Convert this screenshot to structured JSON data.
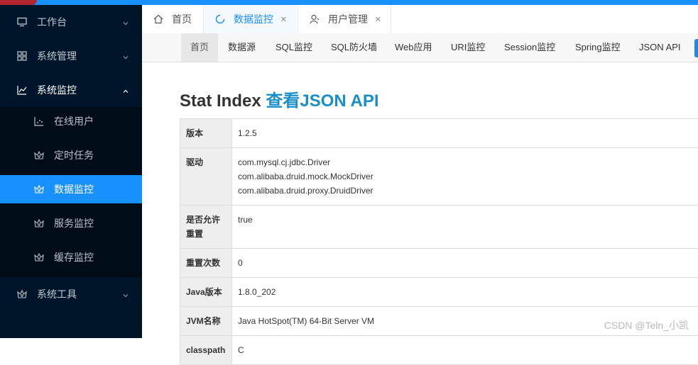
{
  "sidebar": {
    "menu": [
      {
        "label": "工作台",
        "icon": "monitor-icon"
      },
      {
        "label": "系统管理",
        "icon": "grid-icon"
      },
      {
        "label": "系统监控",
        "icon": "line-chart-icon"
      },
      {
        "label": "系统工具",
        "icon": "tools-icon"
      }
    ],
    "submenu": [
      {
        "label": "在线用户",
        "icon": "chart-icon"
      },
      {
        "label": "定时任务",
        "icon": "crown-icon"
      },
      {
        "label": "数据监控",
        "icon": "crown-icon"
      },
      {
        "label": "服务监控",
        "icon": "crown-icon"
      },
      {
        "label": "缓存监控",
        "icon": "crown-icon"
      }
    ],
    "active_submenu": "数据监控"
  },
  "tabs": [
    {
      "label": "首页",
      "icon": "home-icon",
      "closable": false
    },
    {
      "label": "数据监控",
      "icon": "loading-icon",
      "closable": true,
      "active": true
    },
    {
      "label": "用户管理",
      "icon": "user-icon",
      "closable": true
    }
  ],
  "tab_close_glyph": "×",
  "druid_nav": [
    "首页",
    "数据源",
    "SQL监控",
    "SQL防火墙",
    "Web应用",
    "URI监控",
    "Session监控",
    "Spring监控",
    "JSON API"
  ],
  "page": {
    "title": "Stat Index",
    "api_link": "查看JSON API"
  },
  "stats": [
    {
      "key": "版本",
      "values": [
        "1.2.5"
      ]
    },
    {
      "key": "驱动",
      "values": [
        "com.mysql.cj.jdbc.Driver",
        "com.alibaba.druid.mock.MockDriver",
        "com.alibaba.druid.proxy.DruidDriver"
      ]
    },
    {
      "key": "是否允许重置",
      "values": [
        "true"
      ]
    },
    {
      "key": "重置次数",
      "values": [
        "0"
      ]
    },
    {
      "key": "Java版本",
      "values": [
        "1.8.0_202"
      ]
    },
    {
      "key": "JVM名称",
      "values": [
        "Java HotSpot(TM) 64-Bit Server VM"
      ]
    },
    {
      "key": "classpath",
      "values": [
        "C"
      ]
    }
  ],
  "watermark": "CSDN @Teln_小凯",
  "colors": {
    "sidebar_bg": "#001529",
    "submenu_bg": "#000c17",
    "accent": "#1890ff",
    "link": "#1a8ec8"
  }
}
